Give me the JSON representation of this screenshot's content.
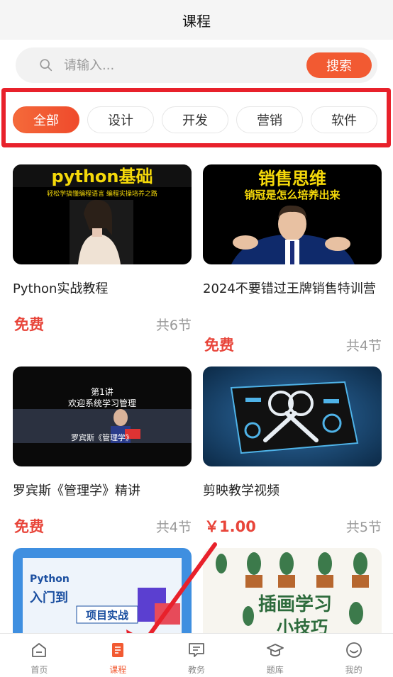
{
  "header": {
    "title": "课程"
  },
  "search": {
    "placeholder": "请输入...",
    "button_label": "搜索"
  },
  "category_tabs": [
    {
      "label": "全部",
      "active": true
    },
    {
      "label": "设计",
      "active": false
    },
    {
      "label": "开发",
      "active": false
    },
    {
      "label": "营销",
      "active": false
    },
    {
      "label": "软件",
      "active": false
    }
  ],
  "courses": [
    {
      "title": "Python实战教程",
      "price": "免费",
      "lessons": "共6节",
      "thumb_text": {
        "headline": "python基础",
        "subline": "轻松学搞懂编程语言 编程实操培养之路"
      }
    },
    {
      "title": "2024不要错过王牌销售特训营",
      "price": "免费",
      "lessons": "共4节",
      "thumb_text": {
        "headline": "销售思维",
        "subline": "销冠是怎么培养出来"
      }
    },
    {
      "title": "罗宾斯《管理学》精讲",
      "price": "免费",
      "lessons": "共4节",
      "thumb_text": {
        "line1": "第1讲",
        "line2": "欢迎系统学习管理",
        "line3": "罗宾斯《管理学》"
      }
    },
    {
      "title": "剪映教学视频",
      "price": "￥1.00",
      "lessons": "共5节"
    },
    {
      "title": "",
      "price": "",
      "lessons": "",
      "thumb_text": {
        "line1": "Python",
        "line2": "入门到",
        "line3": "项目实战"
      }
    },
    {
      "title": "",
      "price": "",
      "lessons": "",
      "thumb_text": {
        "line1": "插画学习",
        "line2": "小技巧"
      }
    }
  ],
  "bottom_nav": [
    {
      "label": "首页",
      "icon": "home-icon",
      "active": false
    },
    {
      "label": "课程",
      "icon": "course-icon",
      "active": true
    },
    {
      "label": "教务",
      "icon": "chat-icon",
      "active": false
    },
    {
      "label": "题库",
      "icon": "graduation-cap-icon",
      "active": false
    },
    {
      "label": "我的",
      "icon": "smile-icon",
      "active": false
    }
  ],
  "colors": {
    "accent": "#f25a32",
    "price": "#e8453a",
    "highlight_box": "#e8212b",
    "annotation_arrow": "#e8212b"
  }
}
